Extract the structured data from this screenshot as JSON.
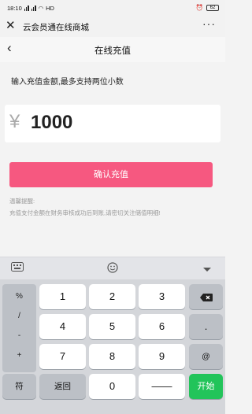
{
  "status": {
    "time": "18:10",
    "network": "HD",
    "battery": "62"
  },
  "appbar": {
    "close": "✕",
    "title": "云会员通在线商城",
    "more": "···"
  },
  "navbar": {
    "back": "‹",
    "title": "在线充值"
  },
  "hint": "输入充值金额,最多支持两位小数",
  "amount": {
    "currency": "¥",
    "value": "1000"
  },
  "confirm_label": "确认充值",
  "tips": {
    "label": "温馨提醒:",
    "text": "充值支付金额在财务审核成功后到账,请密切关注储值明细!"
  },
  "keyboard": {
    "symbols": [
      "%",
      "/",
      "-",
      "+"
    ],
    "digits": [
      "1",
      "2",
      "3",
      "4",
      "5",
      "6",
      "7",
      "8",
      "9"
    ],
    "dot": ".",
    "at": "@",
    "sym_key": "符",
    "back_key": "返回",
    "zero": "0",
    "space": "——",
    "go_key": "开始",
    "delete_icon": "backspace-icon"
  }
}
